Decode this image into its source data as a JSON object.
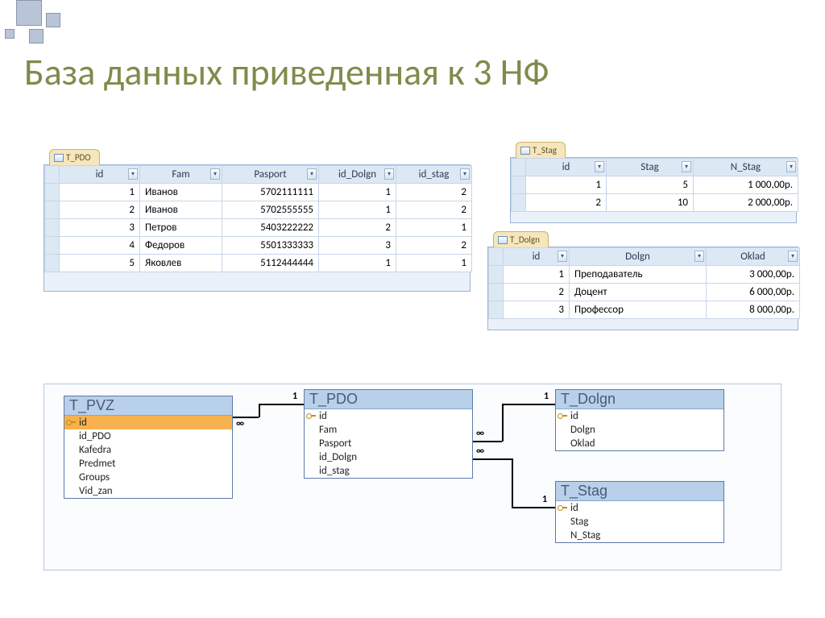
{
  "title": "База данных приведенная к 3 НФ",
  "tables": {
    "pdo": {
      "tabName": "T_PDO",
      "headers": [
        "id",
        "Fam",
        "Pasport",
        "id_Dolgn",
        "id_stag"
      ],
      "rows": [
        {
          "id": "1",
          "fam": "Иванов",
          "pasport": "5702111111",
          "id_dolgn": "1",
          "id_stag": "2"
        },
        {
          "id": "2",
          "fam": "Иванов",
          "pasport": "5702555555",
          "id_dolgn": "1",
          "id_stag": "2"
        },
        {
          "id": "3",
          "fam": "Петров",
          "pasport": "5403222222",
          "id_dolgn": "2",
          "id_stag": "1"
        },
        {
          "id": "4",
          "fam": "Федоров",
          "pasport": "5501333333",
          "id_dolgn": "3",
          "id_stag": "2"
        },
        {
          "id": "5",
          "fam": "Яковлев",
          "pasport": "5112444444",
          "id_dolgn": "1",
          "id_stag": "1"
        }
      ]
    },
    "stag": {
      "tabName": "T_Stag",
      "headers": [
        "id",
        "Stag",
        "N_Stag"
      ],
      "rows": [
        {
          "id": "1",
          "stag": "5",
          "n_stag": "1 000,00р."
        },
        {
          "id": "2",
          "stag": "10",
          "n_stag": "2 000,00р."
        }
      ]
    },
    "dolgn": {
      "tabName": "T_Dolgn",
      "headers": [
        "id",
        "Dolgn",
        "Oklad"
      ],
      "rows": [
        {
          "id": "1",
          "dolgn": "Преподаватель",
          "oklad": "3 000,00р."
        },
        {
          "id": "2",
          "dolgn": "Доцент",
          "oklad": "6 000,00р."
        },
        {
          "id": "3",
          "dolgn": "Профессор",
          "oklad": "8 000,00р."
        }
      ]
    }
  },
  "diagram": {
    "entities": {
      "pvz": {
        "title": "T_PVZ",
        "fields": [
          "id",
          "id_PDO",
          "Kafedra",
          "Predmet",
          "Groups",
          "Vid_zan"
        ],
        "pk": 0
      },
      "pdo": {
        "title": "T_PDO",
        "fields": [
          "id",
          "Fam",
          "Pasport",
          "id_Dolgn",
          "id_stag"
        ],
        "pk": 0
      },
      "dolgn": {
        "title": "T_Dolgn",
        "fields": [
          "id",
          "Dolgn",
          "Oklad"
        ],
        "pk": 0
      },
      "stag": {
        "title": "T_Stag",
        "fields": [
          "id",
          "Stag",
          "N_Stag"
        ],
        "pk": 0
      }
    },
    "cardinality": {
      "one": "1",
      "many": "∞"
    }
  }
}
